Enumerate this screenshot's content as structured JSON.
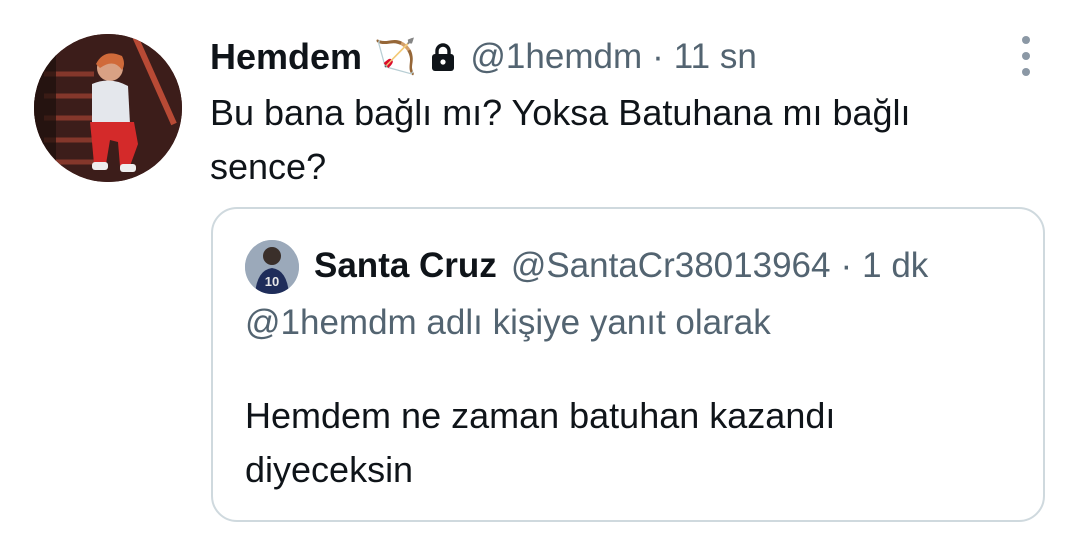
{
  "tweet": {
    "author_name": "Hemdem",
    "author_emoji": "🏹",
    "handle": "@1hemdm",
    "separator": "·",
    "time": "11 sn",
    "text": "Bu bana bağlı mı? Yoksa Batuhana mı bağlı sence?",
    "icons": {
      "more": "more-vertical-icon",
      "lock": "lock-icon"
    }
  },
  "quote": {
    "author_name": "Santa Cruz",
    "handle": "@SantaCr38013964",
    "separator": "·",
    "time": "1 dk",
    "reply_context": "@1hemdm adlı kişiye yanıt olarak",
    "text": "Hemdem ne zaman batuhan kazandı diyeceksin"
  },
  "colors": {
    "primary_text": "#0f1419",
    "secondary_text": "#536471",
    "border": "#cfd9de",
    "background": "#ffffff"
  }
}
